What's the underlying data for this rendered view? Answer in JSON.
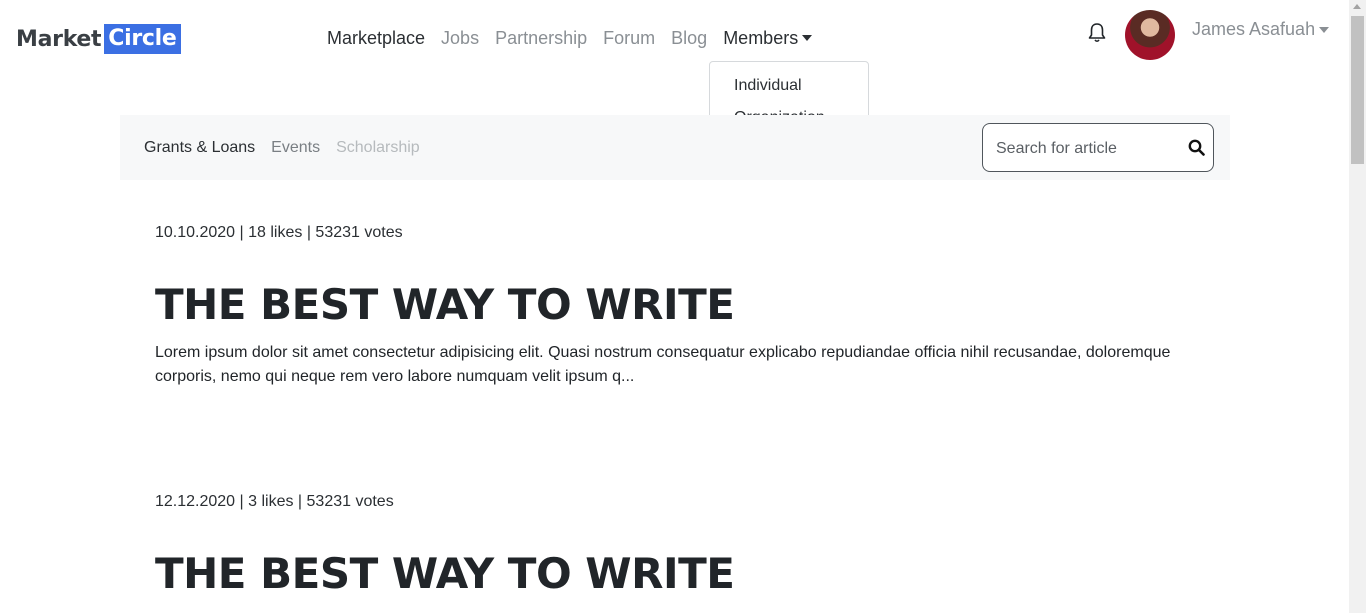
{
  "brand": {
    "part1": "Market",
    "part2": "Circle"
  },
  "nav": {
    "marketplace": "Marketplace",
    "jobs": "Jobs",
    "partnership": "Partnership",
    "forum": "Forum",
    "blog": "Blog",
    "members": "Members"
  },
  "members_dropdown": {
    "individual": "Individual",
    "organization": "Organization"
  },
  "user": {
    "name": "James Asafuah"
  },
  "subnav": {
    "grants": "Grants & Loans",
    "events": "Events",
    "scholarship": "Scholarship"
  },
  "search": {
    "placeholder": "Search for article"
  },
  "articles": [
    {
      "meta": "10.10.2020 | 18 likes | 53231 votes",
      "title": "THE BEST WAY TO WRITE",
      "excerpt": "Lorem ipsum dolor sit amet consectetur adipisicing elit. Quasi nostrum consequatur explicabo repudiandae officia nihil recusandae, doloremque corporis, nemo qui neque rem vero labore numquam velit ipsum q..."
    },
    {
      "meta": "12.12.2020 | 3 likes | 53231 votes",
      "title": "THE BEST WAY TO WRITE"
    }
  ],
  "colors": {
    "brand_accent": "#3b6fe3",
    "subnav_bg": "#f7f8f9"
  }
}
